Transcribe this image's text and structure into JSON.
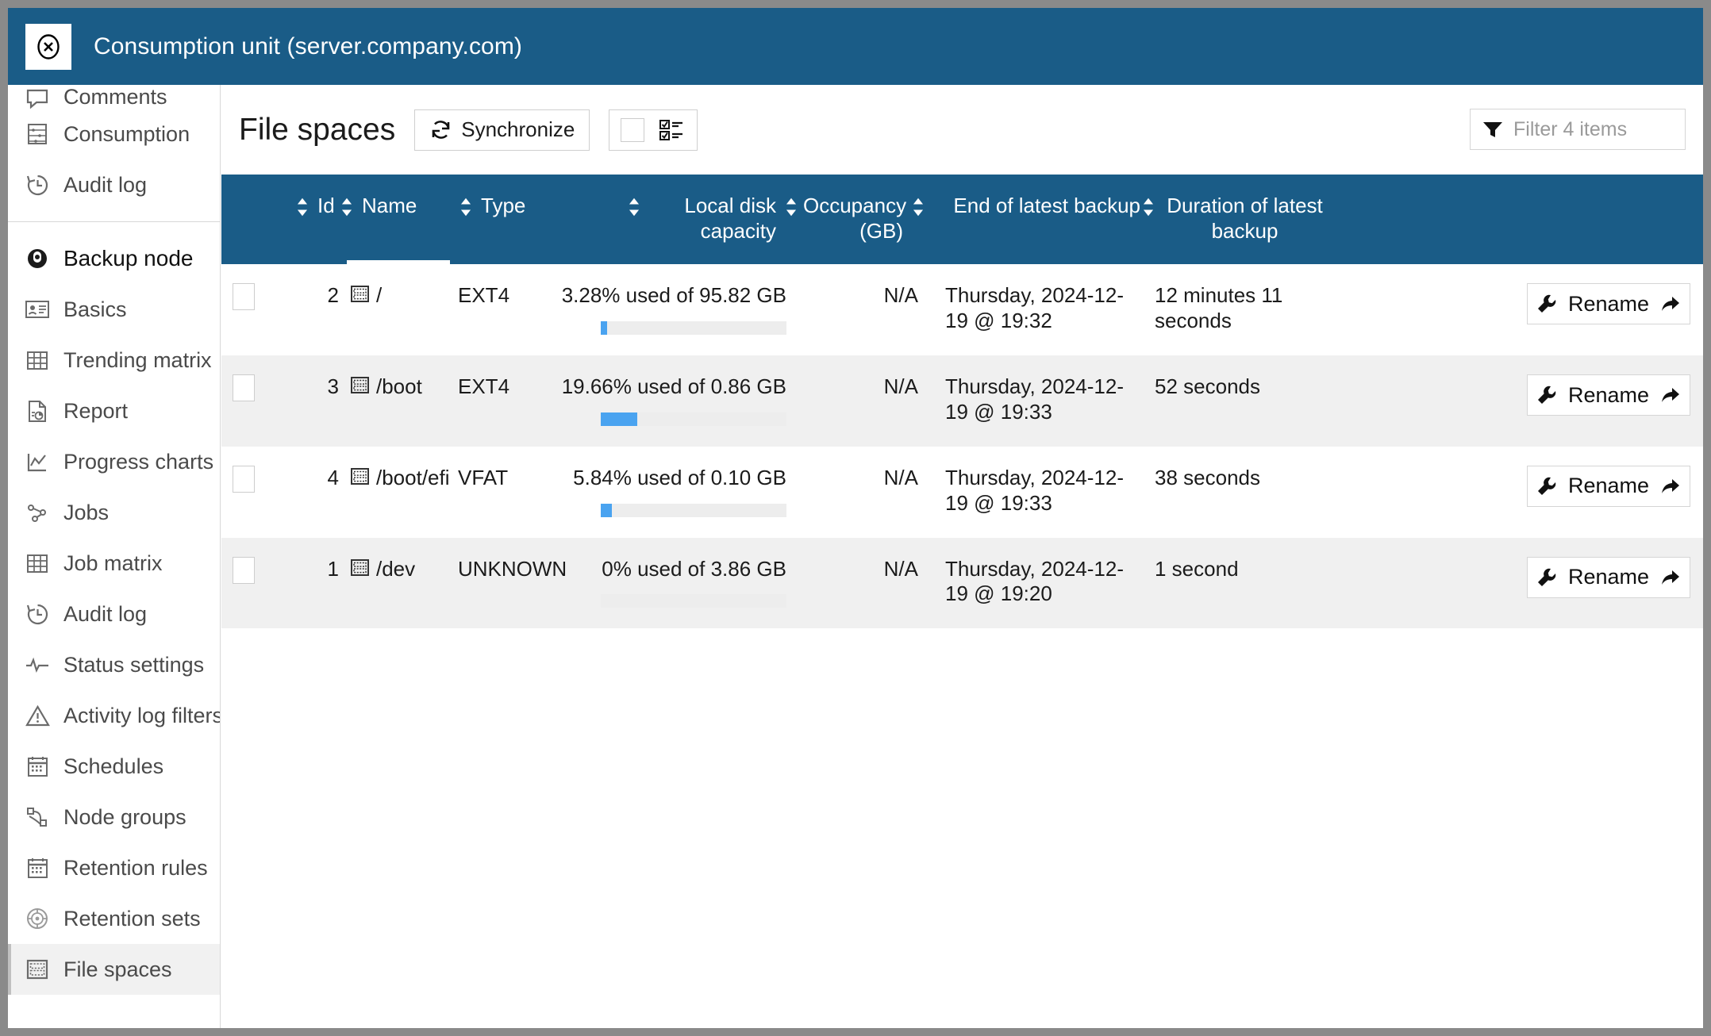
{
  "window": {
    "title": "Consumption unit (server.company.com)",
    "close_icon": "close-circle-icon",
    "accent_color": "#1a5c87"
  },
  "sidebar": {
    "groups": [
      {
        "items": [
          {
            "label": "Comments",
            "icon": "comment-icon",
            "clipped": true
          },
          {
            "label": "Consumption",
            "icon": "abacus-icon"
          },
          {
            "label": "Audit log",
            "icon": "history-icon"
          }
        ]
      },
      {
        "items": [
          {
            "label": "Backup node",
            "icon": "node-icon",
            "group_head": true
          },
          {
            "label": "Basics",
            "icon": "id-card-icon"
          },
          {
            "label": "Trending matrix",
            "icon": "grid-table-icon"
          },
          {
            "label": "Report",
            "icon": "report-document-icon"
          },
          {
            "label": "Progress charts",
            "icon": "line-chart-icon"
          },
          {
            "label": "Jobs",
            "icon": "jobs-nodes-icon"
          },
          {
            "label": "Job matrix",
            "icon": "grid-table-icon"
          },
          {
            "label": "Audit log",
            "icon": "history-icon"
          },
          {
            "label": "Status settings",
            "icon": "pulse-icon"
          },
          {
            "label": "Activity log filters",
            "icon": "warning-triangle-icon"
          },
          {
            "label": "Schedules",
            "icon": "calendar-icon"
          },
          {
            "label": "Node groups",
            "icon": "node-groups-icon"
          },
          {
            "label": "Retention rules",
            "icon": "calendar-icon"
          },
          {
            "label": "Retention sets",
            "icon": "retention-target-icon"
          },
          {
            "label": "File spaces",
            "icon": "file-space-icon",
            "active": true
          }
        ]
      }
    ]
  },
  "toolbar": {
    "page_title": "File spaces",
    "synchronize_label": "Synchronize",
    "synchronize_icon": "refresh-icon",
    "select_all_icon": "checklist-icon",
    "filter_icon": "funnel-icon",
    "filter_placeholder": "Filter 4 items"
  },
  "table": {
    "columns": [
      {
        "key": "check",
        "label": "",
        "sortable": false,
        "align": "left"
      },
      {
        "key": "id",
        "label": "Id",
        "sortable": true,
        "align": "left"
      },
      {
        "key": "name",
        "label": "Name",
        "sortable": true,
        "align": "left",
        "sorted": true
      },
      {
        "key": "type",
        "label": "Type",
        "sortable": true,
        "align": "left"
      },
      {
        "key": "capacity",
        "label": "Local disk capacity",
        "sortable": true,
        "align": "right"
      },
      {
        "key": "occupancy",
        "label": "Occupancy (GB)",
        "sortable": true,
        "align": "right"
      },
      {
        "key": "end_of_backup",
        "label": "End of latest backup",
        "sortable": false,
        "align": "right"
      },
      {
        "key": "duration",
        "label": "Duration of latest backup",
        "sortable": true,
        "align": "left"
      },
      {
        "key": "actions",
        "label": "",
        "sortable": false,
        "align": "right"
      }
    ],
    "rows": [
      {
        "id": "2",
        "name": "/",
        "name_icon": "file-space-icon",
        "type": "EXT4",
        "capacity": "3.28% used of 95.82 GB",
        "capacity_percent": 3.28,
        "occupancy": "N/A",
        "end_of_backup": "Thursday, 2024-12-19 @ 19:32",
        "duration": "12 minutes 11 seconds",
        "action_label": "Rename",
        "action_icon": "wrench-icon",
        "action_secondary_icon": "share-arrow-icon"
      },
      {
        "id": "3",
        "name": "/boot",
        "name_icon": "file-space-icon",
        "type": "EXT4",
        "capacity": "19.66% used of 0.86 GB",
        "capacity_percent": 19.66,
        "occupancy": "N/A",
        "end_of_backup": "Thursday, 2024-12-19 @ 19:33",
        "duration": "52 seconds",
        "action_label": "Rename",
        "action_icon": "wrench-icon",
        "action_secondary_icon": "share-arrow-icon"
      },
      {
        "id": "4",
        "name": "/boot/efi",
        "name_icon": "file-space-icon",
        "type": "VFAT",
        "capacity": "5.84% used of 0.10 GB",
        "capacity_percent": 5.84,
        "occupancy": "N/A",
        "end_of_backup": "Thursday, 2024-12-19 @ 19:33",
        "duration": "38 seconds",
        "action_label": "Rename",
        "action_icon": "wrench-icon",
        "action_secondary_icon": "share-arrow-icon"
      },
      {
        "id": "1",
        "name": "/dev",
        "name_icon": "file-space-icon",
        "type": "UNKNOWN",
        "capacity": "0% used of 3.86 GB",
        "capacity_percent": 0,
        "occupancy": "N/A",
        "end_of_backup": "Thursday, 2024-12-19 @ 19:20",
        "duration": "1 second",
        "action_label": "Rename",
        "action_icon": "wrench-icon",
        "action_secondary_icon": "share-arrow-icon"
      }
    ]
  }
}
